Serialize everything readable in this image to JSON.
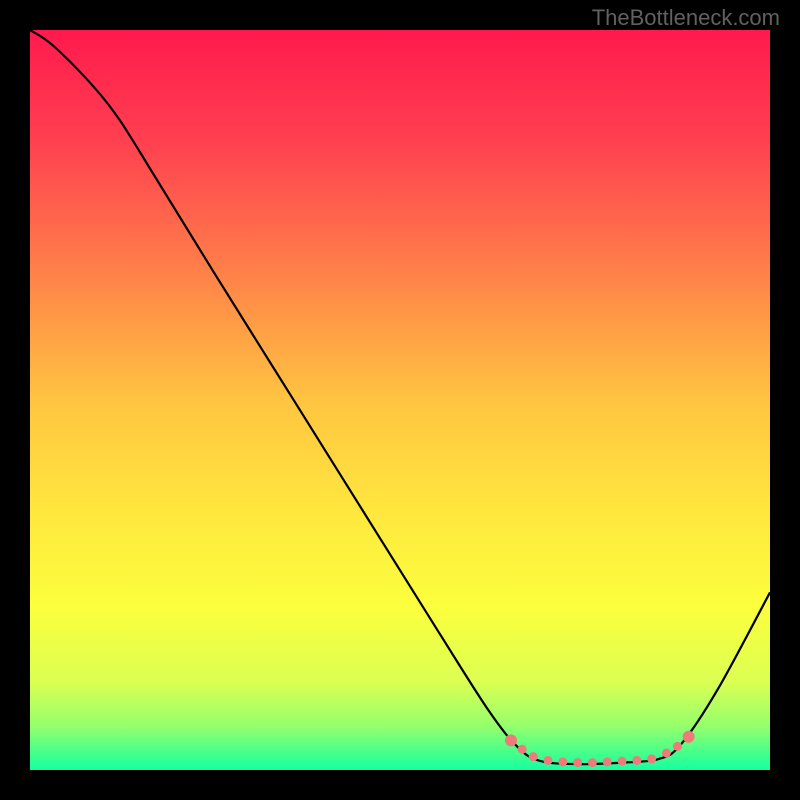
{
  "watermark": "TheBottleneck.com",
  "chart_data": {
    "type": "line",
    "title": "",
    "xlabel": "",
    "ylabel": "",
    "xlim": [
      0,
      100
    ],
    "ylim": [
      0,
      100
    ],
    "gradient_stops": [
      {
        "offset": 0,
        "color": "#ff1a4d"
      },
      {
        "offset": 15,
        "color": "#ff4050"
      },
      {
        "offset": 30,
        "color": "#ff764a"
      },
      {
        "offset": 50,
        "color": "#ffc441"
      },
      {
        "offset": 65,
        "color": "#ffe73e"
      },
      {
        "offset": 78,
        "color": "#fbff3d"
      },
      {
        "offset": 88,
        "color": "#dcff52"
      },
      {
        "offset": 94,
        "color": "#96ff6c"
      },
      {
        "offset": 98,
        "color": "#3eff8e"
      },
      {
        "offset": 100,
        "color": "#16ffa2"
      }
    ],
    "curve": [
      {
        "x": 0,
        "y": 100
      },
      {
        "x": 3,
        "y": 98
      },
      {
        "x": 8,
        "y": 93
      },
      {
        "x": 12,
        "y": 88
      },
      {
        "x": 17,
        "y": 80
      },
      {
        "x": 25,
        "y": 67
      },
      {
        "x": 35,
        "y": 51
      },
      {
        "x": 45,
        "y": 35
      },
      {
        "x": 55,
        "y": 19
      },
      {
        "x": 62,
        "y": 8
      },
      {
        "x": 66,
        "y": 3
      },
      {
        "x": 69,
        "y": 1.2
      },
      {
        "x": 74,
        "y": 0.8
      },
      {
        "x": 80,
        "y": 1
      },
      {
        "x": 85,
        "y": 1.5
      },
      {
        "x": 88,
        "y": 3.5
      },
      {
        "x": 93,
        "y": 11
      },
      {
        "x": 100,
        "y": 24
      }
    ],
    "salmon_dots": [
      {
        "x": 65,
        "y": 4
      },
      {
        "x": 66.5,
        "y": 2.8
      },
      {
        "x": 68,
        "y": 1.8
      },
      {
        "x": 70,
        "y": 1.3
      },
      {
        "x": 72,
        "y": 1.1
      },
      {
        "x": 74,
        "y": 1.0
      },
      {
        "x": 76,
        "y": 1.0
      },
      {
        "x": 78,
        "y": 1.1
      },
      {
        "x": 80,
        "y": 1.2
      },
      {
        "x": 82,
        "y": 1.3
      },
      {
        "x": 84,
        "y": 1.5
      },
      {
        "x": 86,
        "y": 2.3
      },
      {
        "x": 87.5,
        "y": 3.2
      },
      {
        "x": 89,
        "y": 4.5
      }
    ],
    "salmon_color": "#ef7a7a"
  }
}
